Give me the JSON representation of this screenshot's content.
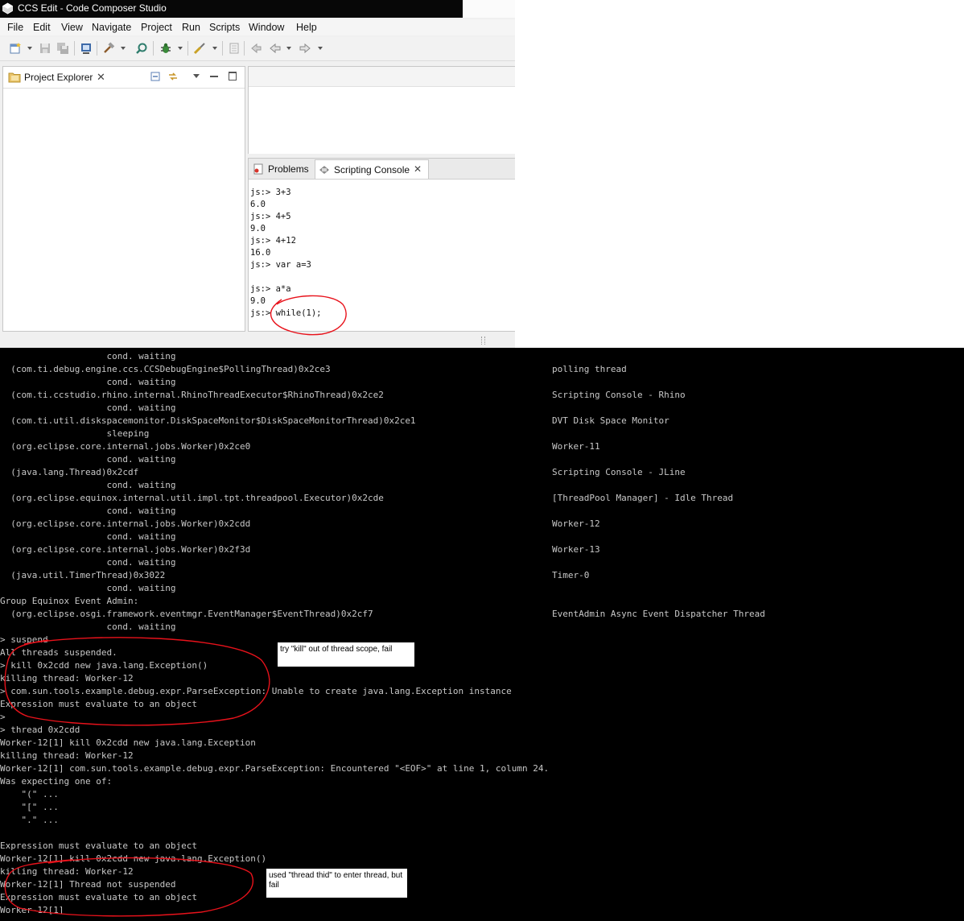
{
  "window": {
    "title": "CCS Edit - Code Composer Studio"
  },
  "menubar": {
    "items": [
      "File",
      "Edit",
      "View",
      "Navigate",
      "Project",
      "Run",
      "Scripts",
      "Window",
      "Help"
    ]
  },
  "explorer": {
    "tab_label": "Project Explorer"
  },
  "console": {
    "tabs": [
      "Problems",
      "Scripting Console"
    ],
    "lines": [
      "js:> 3+3",
      "6.0",
      "js:> 4+5",
      "9.0",
      "js:> 4+12",
      "16.0",
      "js:> var a=3",
      "",
      "js:> a*a",
      "9.0",
      "js:> while(1);"
    ]
  },
  "terminal": {
    "lines": [
      {
        "a": "                    cond. waiting",
        "b": ""
      },
      {
        "a": "  (com.ti.debug.engine.ccs.CCSDebugEngine$PollingThread)0x2ce3",
        "b": "polling thread"
      },
      {
        "a": "                    cond. waiting",
        "b": ""
      },
      {
        "a": "  (com.ti.ccstudio.rhino.internal.RhinoThreadExecutor$RhinoThread)0x2ce2",
        "b": "Scripting Console - Rhino"
      },
      {
        "a": "                    cond. waiting",
        "b": ""
      },
      {
        "a": "  (com.ti.util.diskspacemonitor.DiskSpaceMonitor$DiskSpaceMonitorThread)0x2ce1",
        "b": "DVT Disk Space Monitor"
      },
      {
        "a": "                    sleeping",
        "b": ""
      },
      {
        "a": "  (org.eclipse.core.internal.jobs.Worker)0x2ce0",
        "b": "Worker-11"
      },
      {
        "a": "                    cond. waiting",
        "b": ""
      },
      {
        "a": "  (java.lang.Thread)0x2cdf",
        "b": "Scripting Console - JLine"
      },
      {
        "a": "                    cond. waiting",
        "b": ""
      },
      {
        "a": "  (org.eclipse.equinox.internal.util.impl.tpt.threadpool.Executor)0x2cde",
        "b": "[ThreadPool Manager] - Idle Thread"
      },
      {
        "a": "                    cond. waiting",
        "b": ""
      },
      {
        "a": "  (org.eclipse.core.internal.jobs.Worker)0x2cdd",
        "b": "Worker-12"
      },
      {
        "a": "                    cond. waiting",
        "b": ""
      },
      {
        "a": "  (org.eclipse.core.internal.jobs.Worker)0x2f3d",
        "b": "Worker-13"
      },
      {
        "a": "                    cond. waiting",
        "b": ""
      },
      {
        "a": "  (java.util.TimerThread)0x3022",
        "b": "Timer-0"
      },
      {
        "a": "                    cond. waiting",
        "b": ""
      },
      {
        "a": "Group Equinox Event Admin:",
        "b": ""
      },
      {
        "a": "  (org.eclipse.osgi.framework.eventmgr.EventManager$EventThread)0x2cf7",
        "b": "EventAdmin Async Event Dispatcher Thread"
      },
      {
        "a": "                    cond. waiting",
        "b": ""
      },
      {
        "a": "> suspend",
        "b": ""
      },
      {
        "a": "All threads suspended.",
        "b": ""
      },
      {
        "a": "> kill 0x2cdd new java.lang.Exception()",
        "b": ""
      },
      {
        "a": "killing thread: Worker-12",
        "b": ""
      },
      {
        "a": "> com.sun.tools.example.debug.expr.ParseException: Unable to create java.lang.Exception instance",
        "b": ""
      },
      {
        "a": "Expression must evaluate to an object",
        "b": ""
      },
      {
        "a": ">",
        "b": ""
      },
      {
        "a": "> thread 0x2cdd",
        "b": ""
      },
      {
        "a": "Worker-12[1] kill 0x2cdd new java.lang.Exception",
        "b": ""
      },
      {
        "a": "killing thread: Worker-12",
        "b": ""
      },
      {
        "a": "Worker-12[1] com.sun.tools.example.debug.expr.ParseException: Encountered \"<EOF>\" at line 1, column 24.",
        "b": ""
      },
      {
        "a": "Was expecting one of:",
        "b": ""
      },
      {
        "a": "    \"(\" ...",
        "b": ""
      },
      {
        "a": "    \"[\" ...",
        "b": ""
      },
      {
        "a": "    \".\" ...",
        "b": ""
      },
      {
        "a": "",
        "b": ""
      },
      {
        "a": "Expression must evaluate to an object",
        "b": ""
      },
      {
        "a": "Worker-12[1] kill 0x2cdd new java.lang.Exception()",
        "b": ""
      },
      {
        "a": "killing thread: Worker-12",
        "b": ""
      },
      {
        "a": "Worker-12[1] Thread not suspended",
        "b": ""
      },
      {
        "a": "Expression must evaluate to an object",
        "b": ""
      },
      {
        "a": "Worker-12[1]",
        "b": ""
      }
    ]
  },
  "notes": {
    "note1": "try \"kill\" out of thread scope,  fail",
    "note2": "used \"thread thid\" to enter thread, but fail"
  },
  "colors": {
    "annotation": "#e8121b",
    "terminal_bg": "#000000",
    "terminal_fg": "#c8c8c8"
  }
}
